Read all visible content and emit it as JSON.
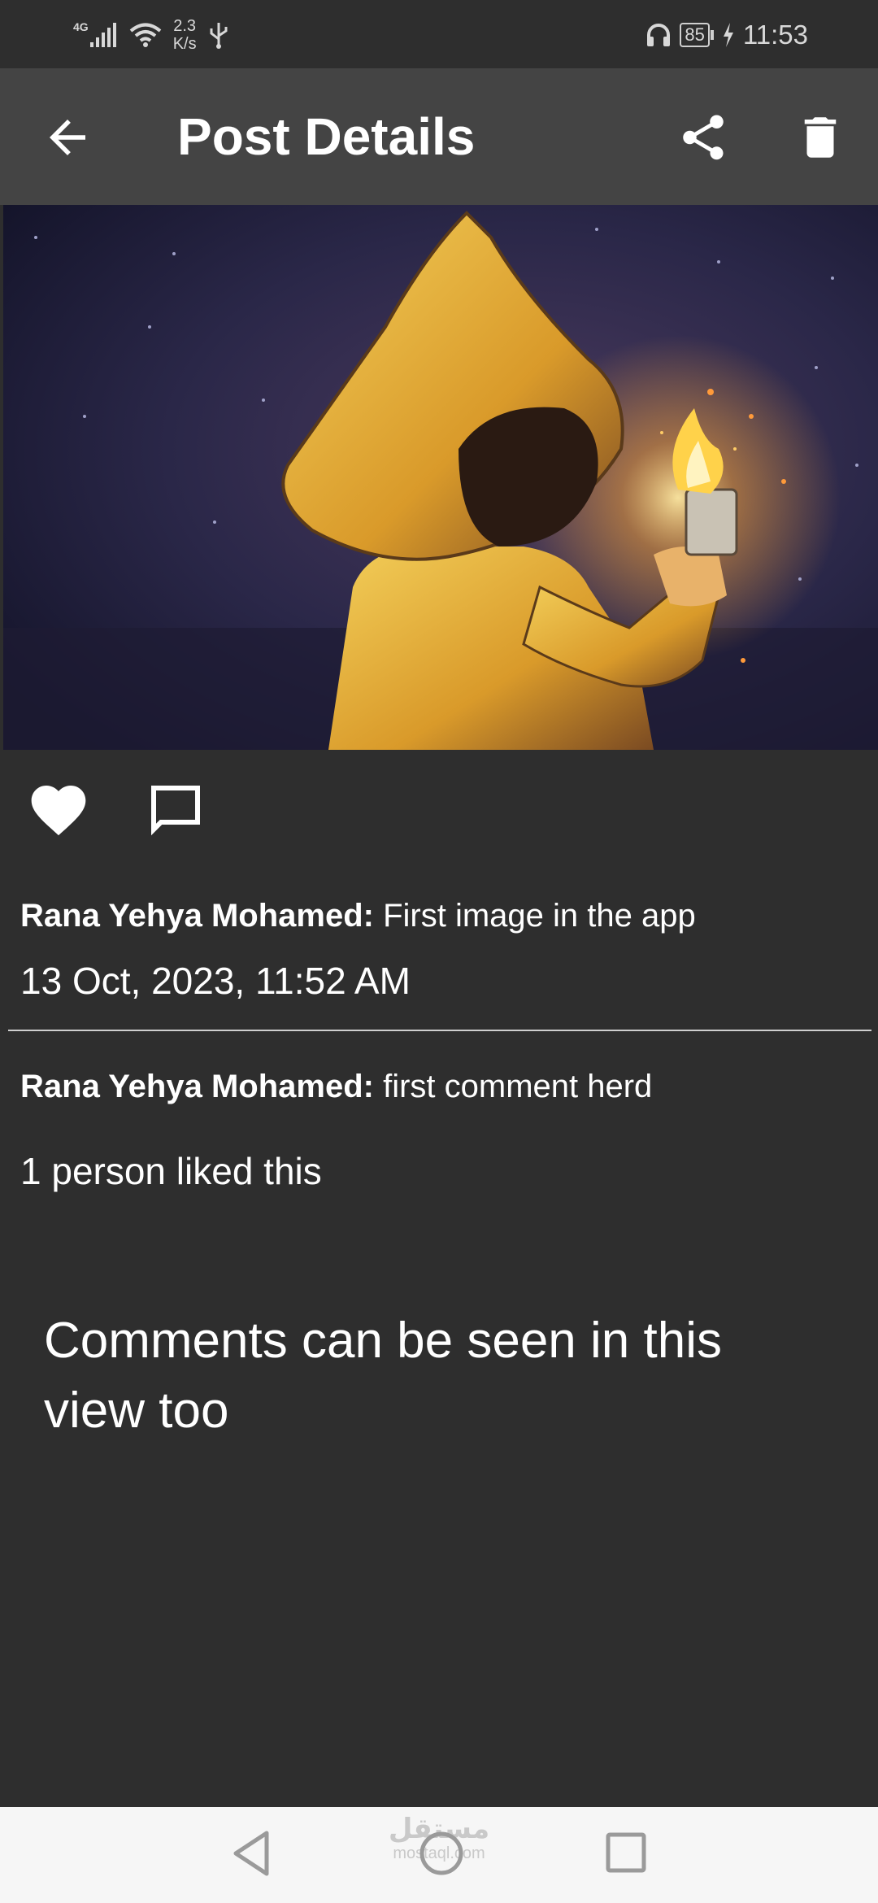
{
  "status_bar": {
    "network_type": "4G",
    "speed_value": "2.3",
    "speed_unit": "K/s",
    "battery_level": "85",
    "time": "11:53",
    "icons": [
      "signal-icon",
      "wifi-icon",
      "usb-icon",
      "headphones-icon",
      "battery-icon",
      "charging-icon"
    ]
  },
  "app_bar": {
    "title": "Post Details",
    "icons": [
      "back-arrow-icon",
      "share-icon",
      "trash-icon"
    ]
  },
  "post": {
    "author": "Rana Yehya Mohamed:",
    "caption": "First image in the app",
    "timestamp": "13 Oct, 2023, 11:52 AM",
    "liked": true,
    "likes_text": "1 person liked this"
  },
  "comments": [
    {
      "author": "Rana Yehya Mohamed:",
      "text": "first comment herd"
    }
  ],
  "annotation": "Comments can be seen in this view too",
  "nav_bar": {
    "watermark_logo": "مستقل",
    "watermark_url": "mostaql.com",
    "icons": [
      "nav-back-icon",
      "nav-home-icon",
      "nav-recents-icon"
    ]
  },
  "colors": {
    "background": "#2e2e2e",
    "app_bar": "#444444",
    "nav_bar": "#f6f6f6",
    "text": "#ffffff"
  }
}
